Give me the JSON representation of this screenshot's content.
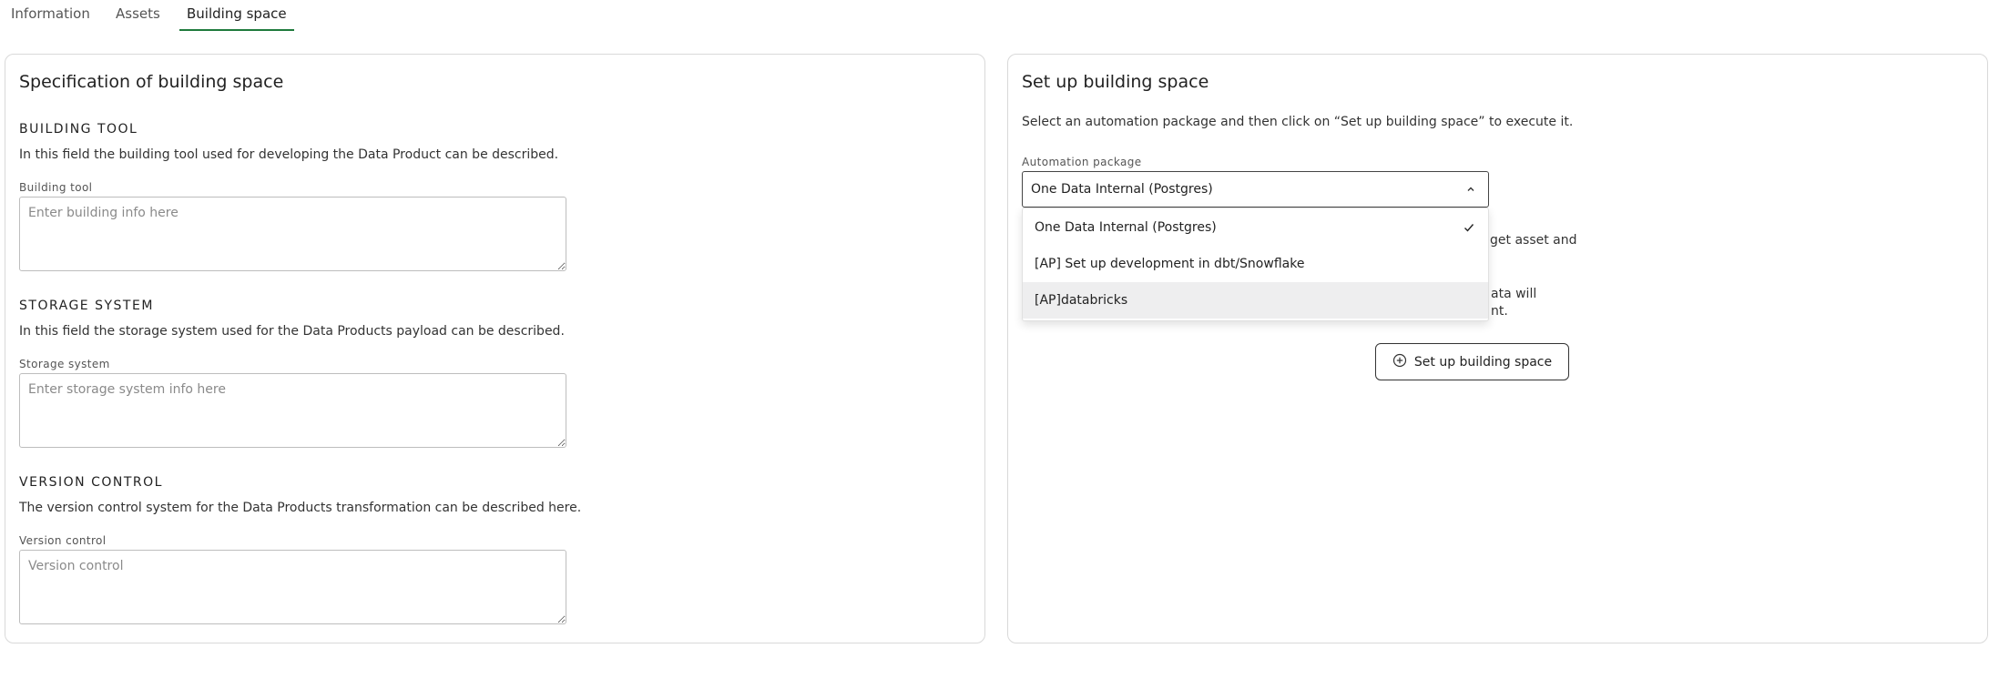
{
  "tabs": [
    {
      "label": "Information"
    },
    {
      "label": "Assets"
    },
    {
      "label": "Building space"
    }
  ],
  "left": {
    "title": "Specification of building space",
    "building_tool": {
      "heading": "BUILDING TOOL",
      "description": "In this field the building tool used for developing the Data Product can be described.",
      "label": "Building tool",
      "placeholder": "Enter building info here"
    },
    "storage_system": {
      "heading": "STORAGE SYSTEM",
      "description": "In this field the storage system used for the Data Products payload can be described.",
      "label": "Storage system",
      "placeholder": "Enter storage system info here"
    },
    "version_control": {
      "heading": "VERSION CONTROL",
      "description": "The version control system for the Data Products transformation can be described here.",
      "label": "Version control",
      "placeholder": "Version control"
    }
  },
  "right": {
    "title": "Set up building space",
    "description": "Select an automation package and then click on “Set up building space” to execute it.",
    "automation_label": "Automation package",
    "selected_value": "One Data Internal (Postgres)",
    "partial_text_1": "get asset and",
    "partial_text_2": "ata will",
    "partial_text_3": "nt.",
    "setup_button": "Set up building space",
    "options": [
      {
        "label": "One Data Internal (Postgres)",
        "selected": true
      },
      {
        "label": "[AP] Set up development in dbt/Snowflake",
        "selected": false
      },
      {
        "label": "[AP]databricks",
        "selected": false
      }
    ]
  },
  "colors": {
    "active_tab_underline": "#1e7a3c",
    "hover_option_bg": "#eeeeef"
  }
}
